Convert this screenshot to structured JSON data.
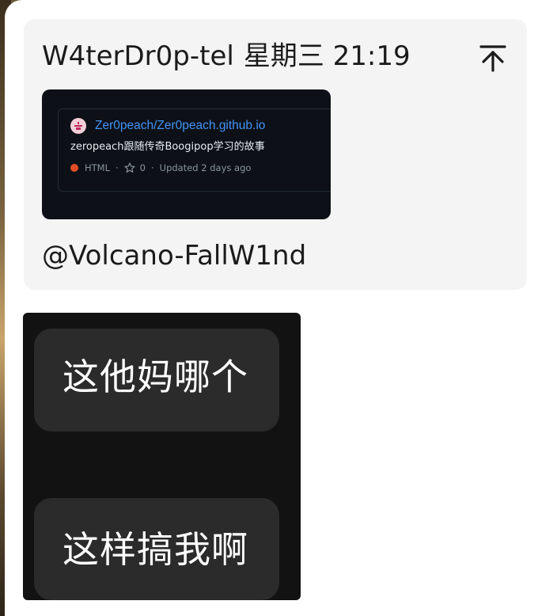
{
  "message": {
    "sender": "W4terDr0p-tel",
    "timestamp": "星期三 21:19",
    "pin_icon": "pin-to-top-icon",
    "mention": "@Volcano-FallW1nd"
  },
  "repo_card": {
    "repo_name": "Zer0peach/Zer0peach.github.io",
    "description": "zeropeach跟随传奇Boogipop学习的故事",
    "language": "HTML",
    "language_color": "#e34c26",
    "stars": "0",
    "updated": "Updated 2 days ago",
    "link_color": "#4493f8"
  },
  "sticker": {
    "line_1": "这他妈哪个",
    "line_2": "这样搞我啊"
  }
}
